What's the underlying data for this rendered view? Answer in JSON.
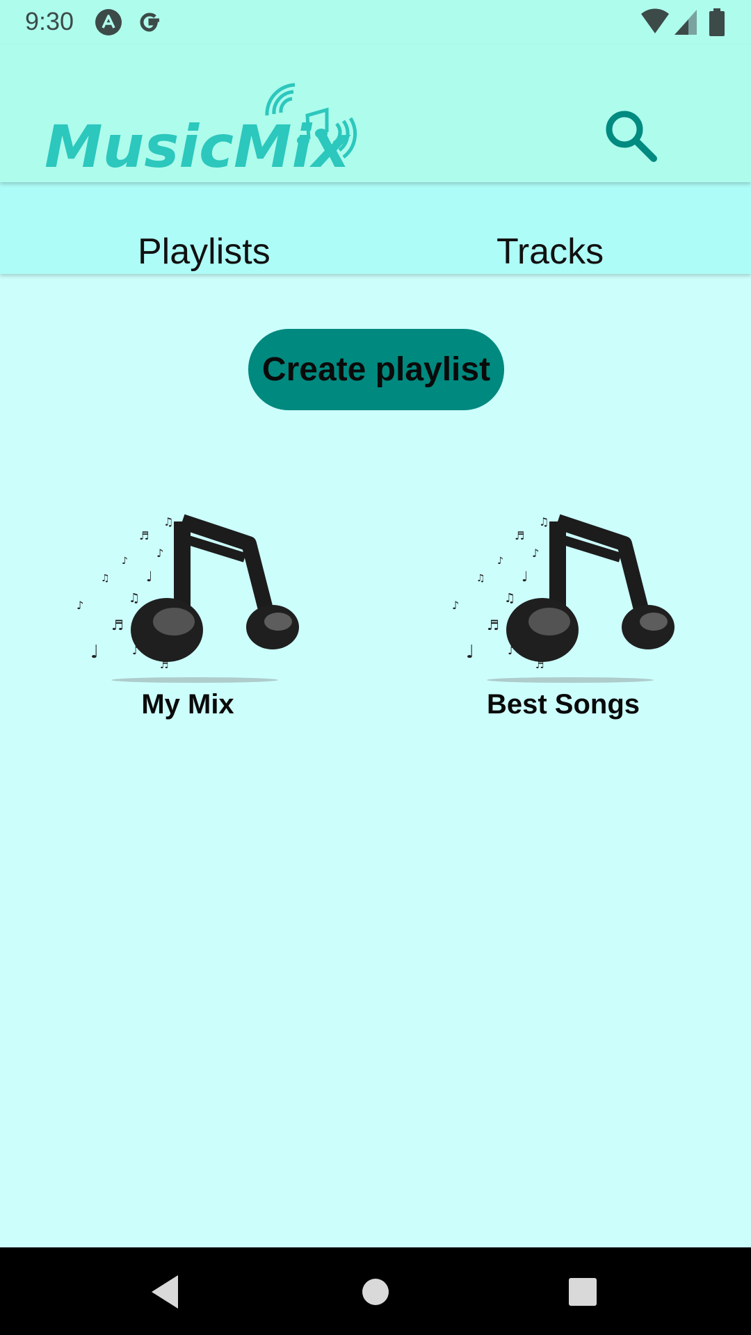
{
  "status_bar": {
    "time": "9:30",
    "icons": [
      "android-auto-icon",
      "google-g-icon",
      "wifi-icon",
      "cell-signal-icon",
      "battery-icon"
    ]
  },
  "app_bar": {
    "logo_text": "MusicMix",
    "search_icon": "search-icon"
  },
  "tabs": [
    {
      "label": "Playlists"
    },
    {
      "label": "Tracks"
    }
  ],
  "create_button": {
    "label": "Create playlist"
  },
  "playlists": [
    {
      "name": "My Mix",
      "art_icon": "music-note-icon"
    },
    {
      "name": "Best Songs",
      "art_icon": "music-note-icon"
    }
  ],
  "nav_bar": {
    "icons": [
      "back-icon",
      "home-icon",
      "recents-icon"
    ]
  },
  "colors": {
    "background": "#ccfffc",
    "app_bar": "#aefcec",
    "accent": "#00897f",
    "logo": "#2cc7bd"
  }
}
